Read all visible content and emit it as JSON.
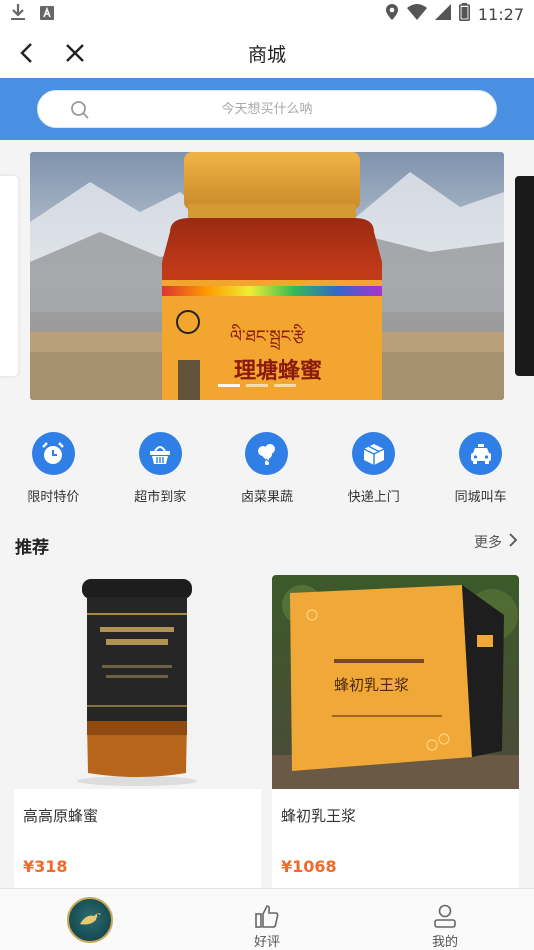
{
  "status_bar": {
    "time": "11:27",
    "left_icons": [
      "download-icon",
      "notification-icon"
    ],
    "right_icons": [
      "location-icon",
      "wifi-icon",
      "signal-icon",
      "battery-icon"
    ]
  },
  "nav": {
    "title": "商城",
    "back_icon": "chevron-left-icon",
    "close_icon": "close-icon"
  },
  "search": {
    "placeholder": "今天想买什么呐",
    "icon": "search-icon"
  },
  "banner": {
    "product_label_tibetan": "ལི་ཐང་སྦྲང་རྩི",
    "product_label": "理塘蜂蜜",
    "slide_count": 3,
    "active_slide": 1
  },
  "categories": [
    {
      "label": "限时特价",
      "icon": "alarm-clock-icon"
    },
    {
      "label": "超市到家",
      "icon": "basket-icon"
    },
    {
      "label": "卤菜果蔬",
      "icon": "broccoli-icon"
    },
    {
      "label": "快递上门",
      "icon": "package-icon"
    },
    {
      "label": "同城叫车",
      "icon": "car-icon"
    }
  ],
  "recommend": {
    "title": "推荐",
    "more": "更多"
  },
  "products": [
    {
      "name": "高高原蜂蜜",
      "price": "¥318"
    },
    {
      "name": "蜂初乳王浆",
      "price": "¥1068",
      "box_text": "蜂初乳王浆"
    }
  ],
  "tabs": [
    {
      "label": "",
      "icon": "logo-icon"
    },
    {
      "label": "好评",
      "icon": "thumbs-up-icon"
    },
    {
      "label": "我的",
      "icon": "user-icon"
    }
  ],
  "colors": {
    "primary": "#2f7fe6",
    "search_band": "#4a90e2",
    "price": "#f06a2b"
  }
}
